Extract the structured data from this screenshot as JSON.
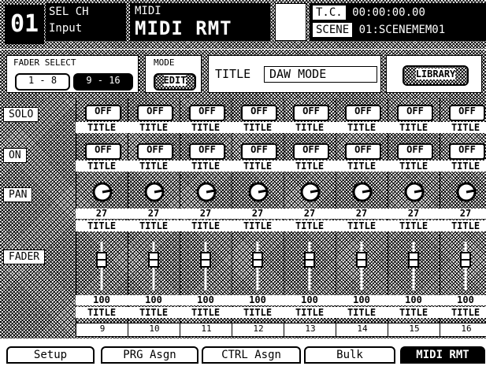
{
  "header": {
    "channel_number": "01",
    "sel_ch_label": "SEL CH",
    "sel_ch_value": "Input",
    "screen_group": "MIDI",
    "screen_title": "MIDI RMT",
    "tc_label": "T.C.",
    "tc_value": "00:00:00.00",
    "scene_label": "SCENE",
    "scene_value": "01:SCENEMEM01"
  },
  "controls": {
    "fader_select_label": "FADER SELECT",
    "fader_1_8": "1 - 8",
    "fader_9_16": "9 - 16",
    "mode_label": "MODE",
    "mode_button": "EDIT",
    "title_label": "TITLE",
    "title_value": "DAW MODE",
    "library_button": "LIBRARY"
  },
  "rows": {
    "solo": "SOLO",
    "on": "ON",
    "pan": "PAN",
    "fader": "FADER"
  },
  "channels": [
    {
      "solo": "OFF",
      "on": "OFF",
      "pan": "27",
      "fader": "100",
      "title": "TITLE",
      "number": "9"
    },
    {
      "solo": "OFF",
      "on": "OFF",
      "pan": "27",
      "fader": "100",
      "title": "TITLE",
      "number": "10"
    },
    {
      "solo": "OFF",
      "on": "OFF",
      "pan": "27",
      "fader": "100",
      "title": "TITLE",
      "number": "11"
    },
    {
      "solo": "OFF",
      "on": "OFF",
      "pan": "27",
      "fader": "100",
      "title": "TITLE",
      "number": "12"
    },
    {
      "solo": "OFF",
      "on": "OFF",
      "pan": "27",
      "fader": "100",
      "title": "TITLE",
      "number": "13"
    },
    {
      "solo": "OFF",
      "on": "OFF",
      "pan": "27",
      "fader": "100",
      "title": "TITLE",
      "number": "14"
    },
    {
      "solo": "OFF",
      "on": "OFF",
      "pan": "27",
      "fader": "100",
      "title": "TITLE",
      "number": "15"
    },
    {
      "solo": "OFF",
      "on": "OFF",
      "pan": "27",
      "fader": "100",
      "title": "TITLE",
      "number": "16"
    }
  ],
  "tabs": [
    {
      "label": "Setup",
      "active": false
    },
    {
      "label": "PRG Asgn",
      "active": false
    },
    {
      "label": "CTRL Asgn",
      "active": false
    },
    {
      "label": "Bulk",
      "active": false
    },
    {
      "label": "MIDI RMT",
      "active": true
    }
  ]
}
